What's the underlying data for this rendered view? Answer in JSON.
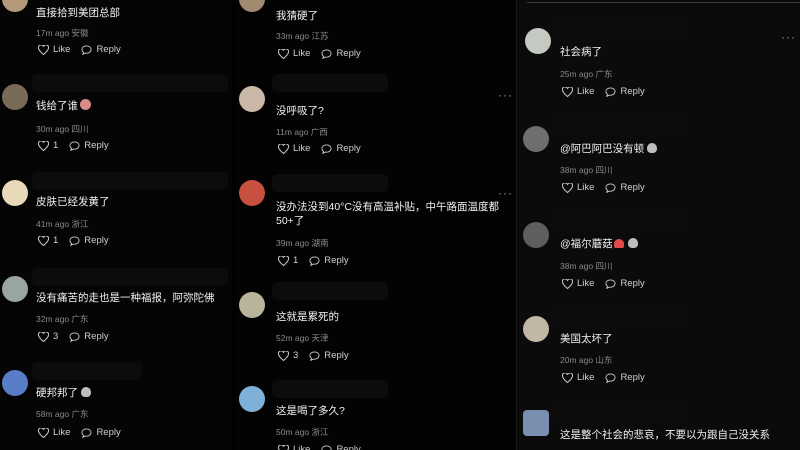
{
  "actions": {
    "like": "Like",
    "reply": "Reply"
  },
  "col1": [
    {
      "text": "直接拾到美团总部",
      "meta": "17m ago  安徽",
      "likes": ""
    },
    {
      "text": "钱给了谁",
      "meta": "30m ago  四川",
      "likes": "1"
    },
    {
      "text": "皮肤已经发黄了",
      "meta": "41m ago  浙江",
      "likes": "1"
    },
    {
      "text": "没有痛苦的走也是一种福报，阿弥陀佛",
      "meta": "32m ago  广东",
      "likes": "3"
    },
    {
      "text": "硬邦邦了",
      "meta": "58m ago  广东",
      "likes": ""
    }
  ],
  "col2": [
    {
      "text": "我猜硬了",
      "meta": "33m ago  江苏",
      "likes": ""
    },
    {
      "text": "没呼吸了?",
      "meta": "11m ago  广西",
      "likes": ""
    },
    {
      "text": "没办法没到40°C没有高温补贴，中午路面温度都50+了",
      "meta": "39m ago  湖南",
      "likes": "1"
    },
    {
      "text": "这就是累死的",
      "meta": "52m ago  天津",
      "likes": "3"
    },
    {
      "text": "这是喝了多久?",
      "meta": "50m ago  浙江",
      "likes": ""
    }
  ],
  "col3": [
    {
      "text": "社会病了",
      "meta": "25m ago  广东",
      "likes": ""
    },
    {
      "text": "@阿巴阿巴没有顿",
      "meta": "38m ago  四川",
      "likes": ""
    },
    {
      "text": "@福尔蘑菇",
      "meta": "38m ago  四川",
      "likes": ""
    },
    {
      "text": "美国太坏了",
      "meta": "20m ago  山东",
      "likes": ""
    },
    {
      "text": "这是整个社会的悲哀，不要以为跟自己没关系",
      "meta": "",
      "likes": ""
    }
  ],
  "colors": {
    "background": "#000000",
    "text": "#f0f0f0",
    "meta": "#8a8a8a",
    "redaction": "#000000"
  },
  "icons": {
    "like": "heart-outline-icon",
    "reply": "speech-bubble-icon",
    "more": "more-dots-icon"
  }
}
